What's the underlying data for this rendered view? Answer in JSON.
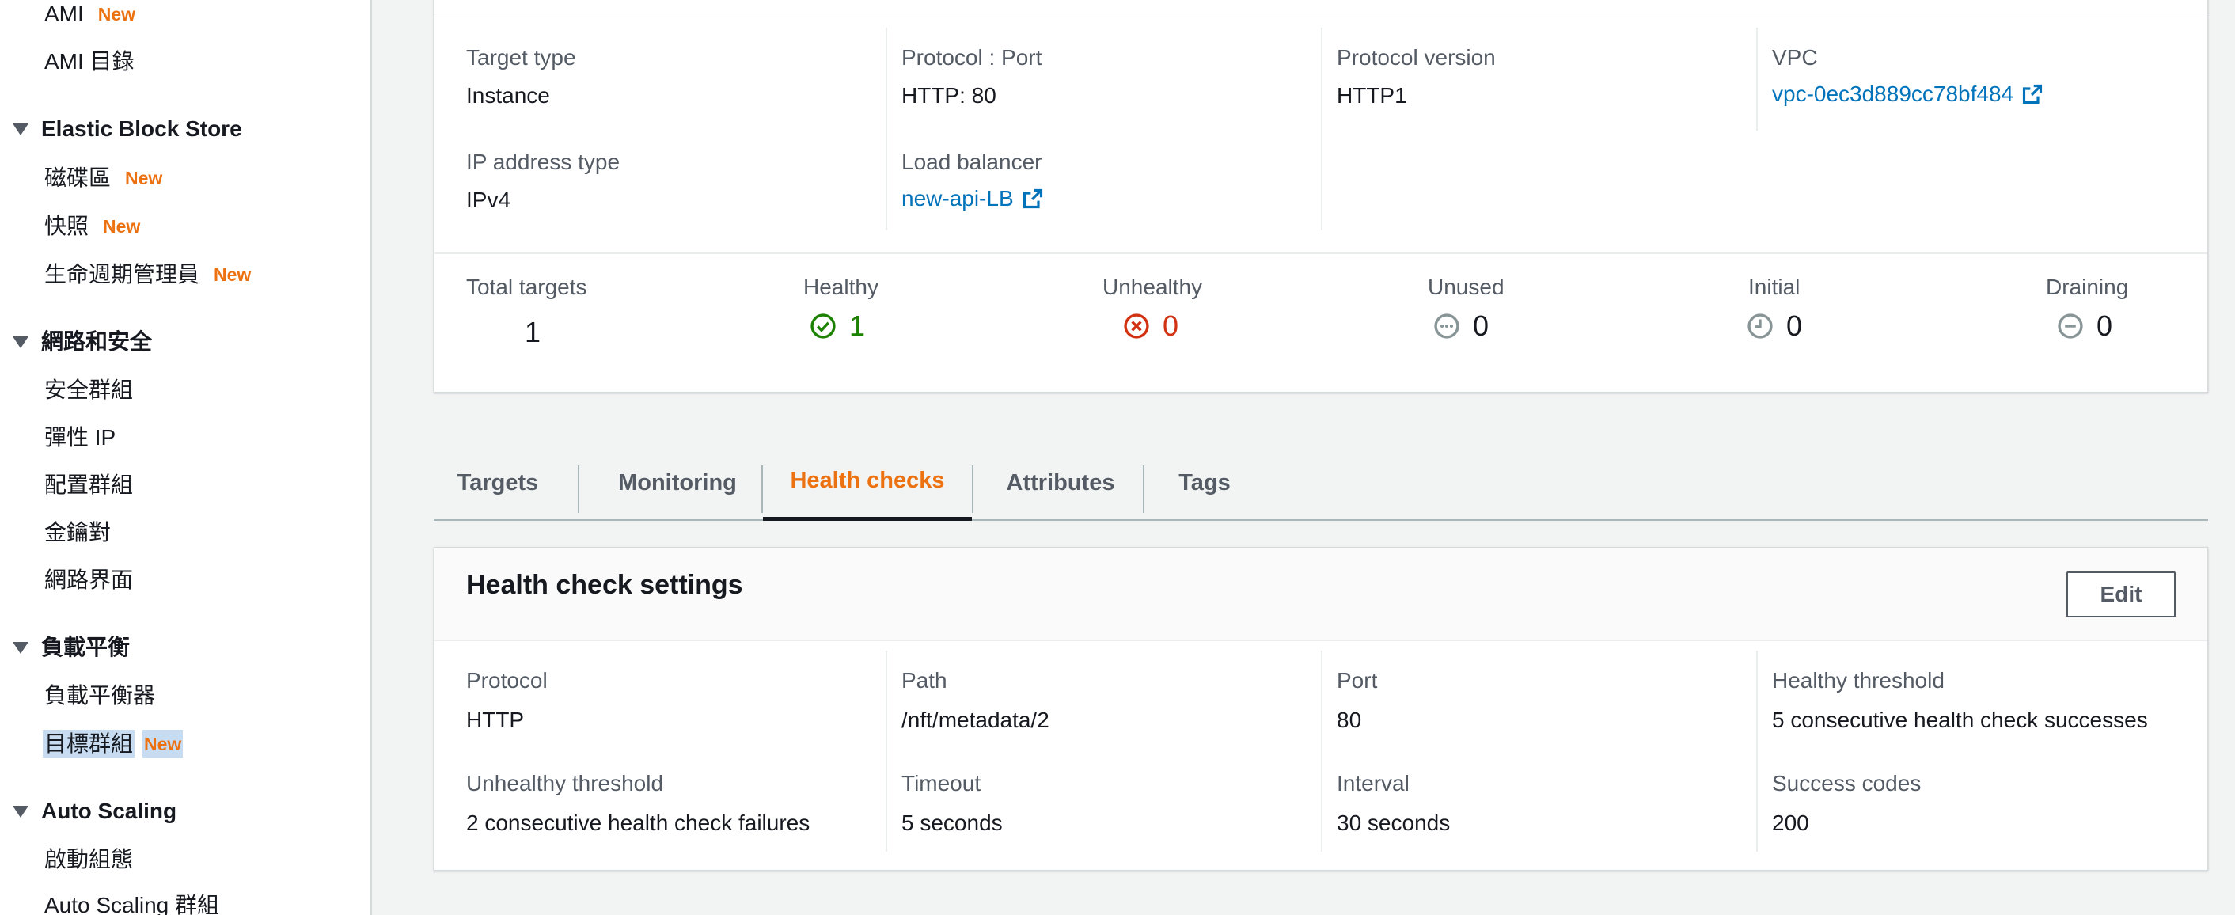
{
  "sidebar": {
    "ami": "AMI",
    "ami_new": "New",
    "ami_catalog": "AMI 目錄",
    "ebs_section": "Elastic Block Store",
    "volumes": "磁碟區",
    "volumes_new": "New",
    "snapshots": "快照",
    "snapshots_new": "New",
    "lifecycle": "生命週期管理員",
    "lifecycle_new": "New",
    "network_section": "網路和安全",
    "security_groups": "安全群組",
    "elastic_ip": "彈性 IP",
    "placement_groups": "配置群組",
    "key_pairs": "金鑰對",
    "network_interfaces": "網路界面",
    "lb_section": "負載平衡",
    "load_balancers": "負載平衡器",
    "target_groups": "目標群組",
    "target_groups_new": "New",
    "as_section": "Auto Scaling",
    "launch_configs": "啟動組態",
    "as_groups": "Auto Scaling 群組"
  },
  "details": {
    "target_type_label": "Target type",
    "target_type": "Instance",
    "protocol_port_label": "Protocol : Port",
    "protocol_port": "HTTP: 80",
    "protocol_version_label": "Protocol version",
    "protocol_version": "HTTP1",
    "vpc_label": "VPC",
    "vpc": "vpc-0ec3d889cc78bf484",
    "ip_type_label": "IP address type",
    "ip_type": "IPv4",
    "lb_label": "Load balancer",
    "lb": "new-api-LB"
  },
  "counts": {
    "total_label": "Total targets",
    "total": "1",
    "healthy_label": "Healthy",
    "healthy": "1",
    "unhealthy_label": "Unhealthy",
    "unhealthy": "0",
    "unused_label": "Unused",
    "unused": "0",
    "initial_label": "Initial",
    "initial": "0",
    "draining_label": "Draining",
    "draining": "0"
  },
  "tabs": {
    "targets": "Targets",
    "monitoring": "Monitoring",
    "health_checks": "Health checks",
    "attributes": "Attributes",
    "tags": "Tags"
  },
  "health": {
    "title": "Health check settings",
    "edit": "Edit",
    "protocol_label": "Protocol",
    "protocol": "HTTP",
    "path_label": "Path",
    "path": "/nft/metadata/2",
    "port_label": "Port",
    "port": "80",
    "healthy_threshold_label": "Healthy threshold",
    "healthy_threshold": "5 consecutive health check successes",
    "unhealthy_threshold_label": "Unhealthy threshold",
    "unhealthy_threshold": "2 consecutive health check failures",
    "timeout_label": "Timeout",
    "timeout": "5 seconds",
    "interval_label": "Interval",
    "interval": "30 seconds",
    "success_codes_label": "Success codes",
    "success_codes": "200"
  },
  "colors": {
    "healthy": "#1d8102",
    "unhealthy": "#d13212",
    "neutral": "#879596",
    "link": "#0073bb",
    "active_tab": "#ec7211",
    "new_badge": "#ec7211"
  }
}
